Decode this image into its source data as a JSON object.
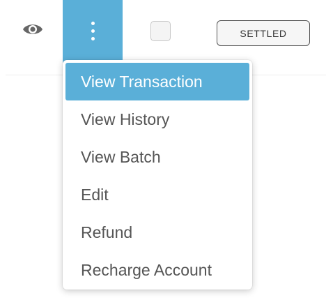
{
  "colors": {
    "accent": "#5aafd8",
    "icon_gray": "#666666",
    "text": "#555555",
    "badge_border": "#555555"
  },
  "row": {
    "view_icon": "eye-icon",
    "actions_icon": "vertical-dots-icon",
    "status": "SETTLED"
  },
  "menu": {
    "items": [
      {
        "label": "View Transaction",
        "active": true
      },
      {
        "label": "View History",
        "active": false
      },
      {
        "label": "View Batch",
        "active": false
      },
      {
        "label": "Edit",
        "active": false
      },
      {
        "label": "Refund",
        "active": false
      },
      {
        "label": "Recharge Account",
        "active": false
      }
    ]
  }
}
